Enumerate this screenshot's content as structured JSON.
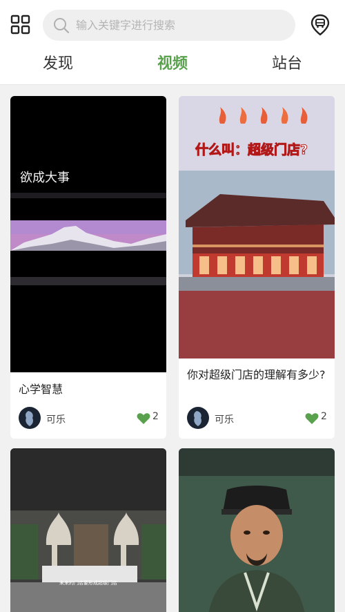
{
  "search": {
    "placeholder": "输入关键字进行搜索"
  },
  "tabs": [
    {
      "label": "发现"
    },
    {
      "label": "视频"
    },
    {
      "label": "站台"
    }
  ],
  "active_tab": "视频",
  "colors": {
    "accent": "#5aa14e",
    "heart": "#5aa14e"
  },
  "cards": [
    {
      "title": "心学智慧",
      "thumb_text": "欲成大事",
      "author": "可乐",
      "likes": "2"
    },
    {
      "title": "你对超级门店的理解有多少?",
      "thumb_text": "什么叫：超级门店?",
      "author": "可乐",
      "likes": "2"
    },
    {
      "title": "",
      "thumb_text": "未来的门店要形成超级门店",
      "author": "",
      "likes": ""
    },
    {
      "title": "",
      "thumb_text": "",
      "author": "",
      "likes": ""
    }
  ],
  "icons": {
    "menu": "grid-icon",
    "search": "search-icon",
    "location": "bus-stop-icon",
    "like": "heart-icon"
  }
}
